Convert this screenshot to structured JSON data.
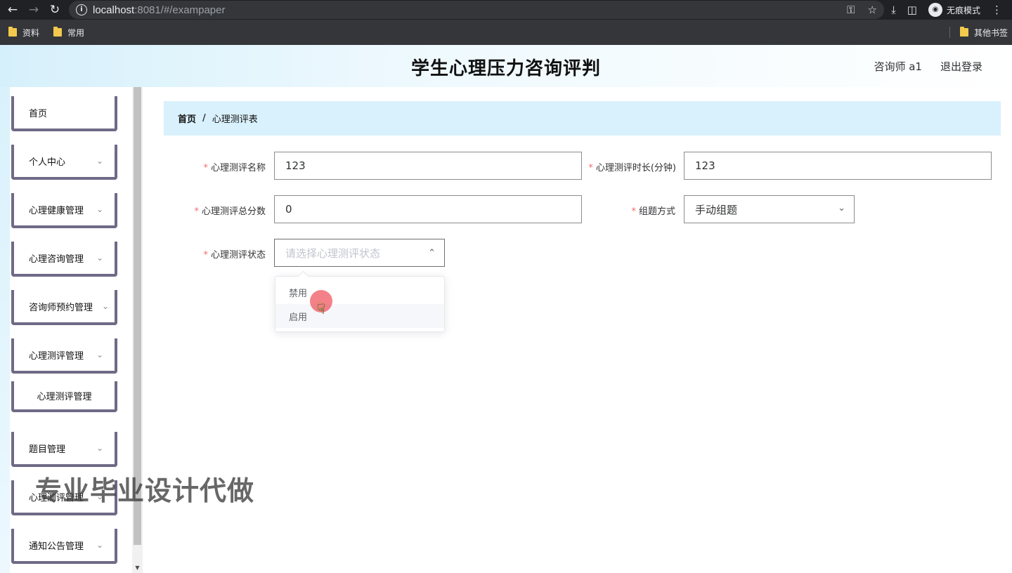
{
  "browser": {
    "url_host": "localhost",
    "url_rest": ":8081/#/exampaper",
    "incognito_label": "无痕模式",
    "bookmarks": [
      "资料",
      "常用"
    ],
    "other_bookmarks": "其他书签"
  },
  "header": {
    "title": "学生心理压力咨询评判",
    "user": "咨询师 a1",
    "logout": "退出登录"
  },
  "sidebar": {
    "items": [
      {
        "label": "首页"
      },
      {
        "label": "个人中心"
      },
      {
        "label": "心理健康管理"
      },
      {
        "label": "心理咨询管理"
      },
      {
        "label": "咨询师预约管理"
      },
      {
        "label": "心理测评管理"
      },
      {
        "label": "心理测评管理"
      },
      {
        "label": "题目管理"
      },
      {
        "label": "心理测评管理"
      },
      {
        "label": "通知公告管理"
      }
    ]
  },
  "breadcrumb": {
    "home": "首页",
    "separator": "/",
    "current": "心理测评表"
  },
  "form": {
    "name": {
      "label": "心理测评名称",
      "value": "123"
    },
    "duration": {
      "label": "心理测评时长(分钟)",
      "value": "123"
    },
    "total_score": {
      "label": "心理测评总分数",
      "value": "0"
    },
    "method": {
      "label": "组题方式",
      "value": "手动组题"
    },
    "status": {
      "label": "心理测评状态",
      "placeholder": "请选择心理测评状态"
    }
  },
  "status_dropdown": {
    "options": [
      "禁用",
      "启用"
    ],
    "hovered": "启用"
  },
  "watermark": "专业毕业设计代做"
}
